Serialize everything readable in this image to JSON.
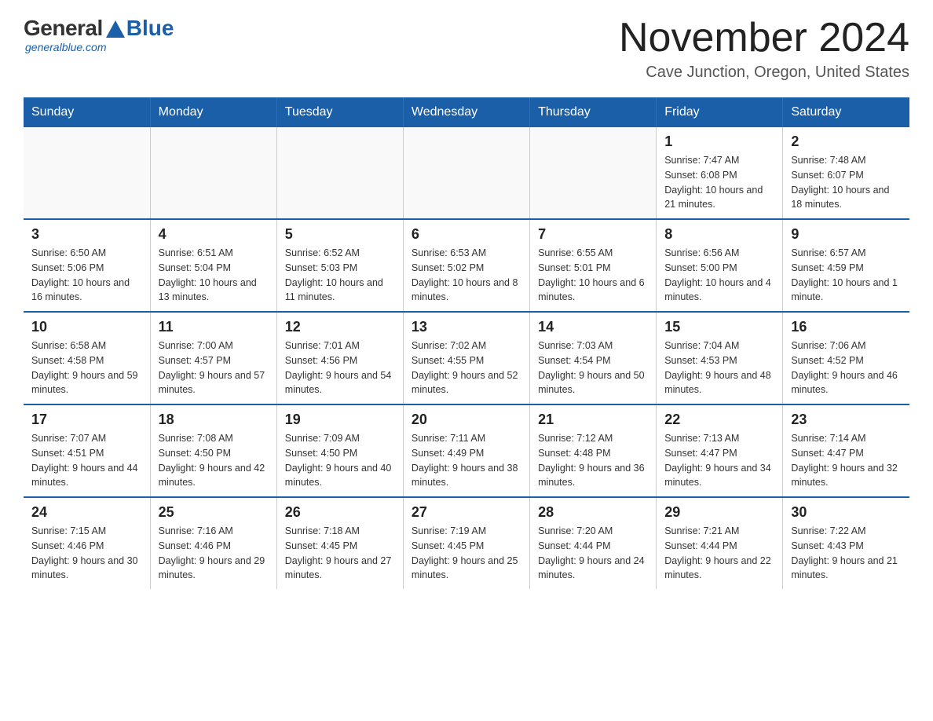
{
  "logo": {
    "general": "General",
    "blue": "Blue",
    "subtitle": "generalblue.com"
  },
  "title": "November 2024",
  "location": "Cave Junction, Oregon, United States",
  "days_of_week": [
    "Sunday",
    "Monday",
    "Tuesday",
    "Wednesday",
    "Thursday",
    "Friday",
    "Saturday"
  ],
  "weeks": [
    [
      {
        "day": "",
        "info": ""
      },
      {
        "day": "",
        "info": ""
      },
      {
        "day": "",
        "info": ""
      },
      {
        "day": "",
        "info": ""
      },
      {
        "day": "",
        "info": ""
      },
      {
        "day": "1",
        "info": "Sunrise: 7:47 AM\nSunset: 6:08 PM\nDaylight: 10 hours and 21 minutes."
      },
      {
        "day": "2",
        "info": "Sunrise: 7:48 AM\nSunset: 6:07 PM\nDaylight: 10 hours and 18 minutes."
      }
    ],
    [
      {
        "day": "3",
        "info": "Sunrise: 6:50 AM\nSunset: 5:06 PM\nDaylight: 10 hours and 16 minutes."
      },
      {
        "day": "4",
        "info": "Sunrise: 6:51 AM\nSunset: 5:04 PM\nDaylight: 10 hours and 13 minutes."
      },
      {
        "day": "5",
        "info": "Sunrise: 6:52 AM\nSunset: 5:03 PM\nDaylight: 10 hours and 11 minutes."
      },
      {
        "day": "6",
        "info": "Sunrise: 6:53 AM\nSunset: 5:02 PM\nDaylight: 10 hours and 8 minutes."
      },
      {
        "day": "7",
        "info": "Sunrise: 6:55 AM\nSunset: 5:01 PM\nDaylight: 10 hours and 6 minutes."
      },
      {
        "day": "8",
        "info": "Sunrise: 6:56 AM\nSunset: 5:00 PM\nDaylight: 10 hours and 4 minutes."
      },
      {
        "day": "9",
        "info": "Sunrise: 6:57 AM\nSunset: 4:59 PM\nDaylight: 10 hours and 1 minute."
      }
    ],
    [
      {
        "day": "10",
        "info": "Sunrise: 6:58 AM\nSunset: 4:58 PM\nDaylight: 9 hours and 59 minutes."
      },
      {
        "day": "11",
        "info": "Sunrise: 7:00 AM\nSunset: 4:57 PM\nDaylight: 9 hours and 57 minutes."
      },
      {
        "day": "12",
        "info": "Sunrise: 7:01 AM\nSunset: 4:56 PM\nDaylight: 9 hours and 54 minutes."
      },
      {
        "day": "13",
        "info": "Sunrise: 7:02 AM\nSunset: 4:55 PM\nDaylight: 9 hours and 52 minutes."
      },
      {
        "day": "14",
        "info": "Sunrise: 7:03 AM\nSunset: 4:54 PM\nDaylight: 9 hours and 50 minutes."
      },
      {
        "day": "15",
        "info": "Sunrise: 7:04 AM\nSunset: 4:53 PM\nDaylight: 9 hours and 48 minutes."
      },
      {
        "day": "16",
        "info": "Sunrise: 7:06 AM\nSunset: 4:52 PM\nDaylight: 9 hours and 46 minutes."
      }
    ],
    [
      {
        "day": "17",
        "info": "Sunrise: 7:07 AM\nSunset: 4:51 PM\nDaylight: 9 hours and 44 minutes."
      },
      {
        "day": "18",
        "info": "Sunrise: 7:08 AM\nSunset: 4:50 PM\nDaylight: 9 hours and 42 minutes."
      },
      {
        "day": "19",
        "info": "Sunrise: 7:09 AM\nSunset: 4:50 PM\nDaylight: 9 hours and 40 minutes."
      },
      {
        "day": "20",
        "info": "Sunrise: 7:11 AM\nSunset: 4:49 PM\nDaylight: 9 hours and 38 minutes."
      },
      {
        "day": "21",
        "info": "Sunrise: 7:12 AM\nSunset: 4:48 PM\nDaylight: 9 hours and 36 minutes."
      },
      {
        "day": "22",
        "info": "Sunrise: 7:13 AM\nSunset: 4:47 PM\nDaylight: 9 hours and 34 minutes."
      },
      {
        "day": "23",
        "info": "Sunrise: 7:14 AM\nSunset: 4:47 PM\nDaylight: 9 hours and 32 minutes."
      }
    ],
    [
      {
        "day": "24",
        "info": "Sunrise: 7:15 AM\nSunset: 4:46 PM\nDaylight: 9 hours and 30 minutes."
      },
      {
        "day": "25",
        "info": "Sunrise: 7:16 AM\nSunset: 4:46 PM\nDaylight: 9 hours and 29 minutes."
      },
      {
        "day": "26",
        "info": "Sunrise: 7:18 AM\nSunset: 4:45 PM\nDaylight: 9 hours and 27 minutes."
      },
      {
        "day": "27",
        "info": "Sunrise: 7:19 AM\nSunset: 4:45 PM\nDaylight: 9 hours and 25 minutes."
      },
      {
        "day": "28",
        "info": "Sunrise: 7:20 AM\nSunset: 4:44 PM\nDaylight: 9 hours and 24 minutes."
      },
      {
        "day": "29",
        "info": "Sunrise: 7:21 AM\nSunset: 4:44 PM\nDaylight: 9 hours and 22 minutes."
      },
      {
        "day": "30",
        "info": "Sunrise: 7:22 AM\nSunset: 4:43 PM\nDaylight: 9 hours and 21 minutes."
      }
    ]
  ]
}
